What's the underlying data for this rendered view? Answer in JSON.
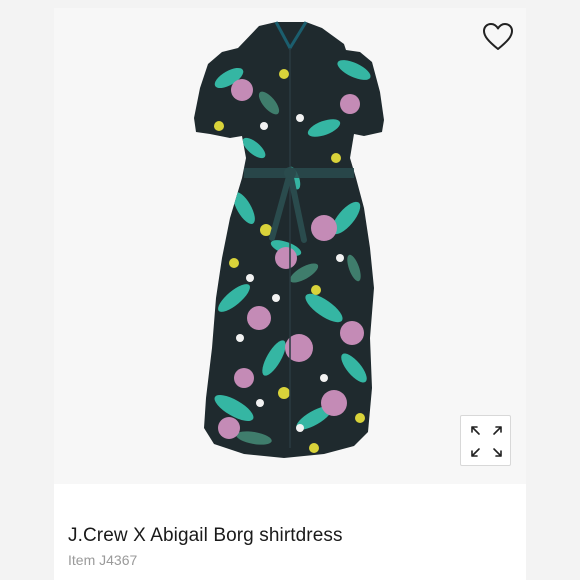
{
  "product": {
    "title": "J.Crew X Abigail Borg shirtdress",
    "item_number": "Item J4367",
    "image_alt": "floral-print-shirtdress"
  },
  "actions": {
    "favorite_icon": "heart-outline-icon",
    "expand_icon": "expand-arrows-icon"
  },
  "colors": {
    "page_bg": "#f3f3f3",
    "card_bg": "#ffffff",
    "dress_base": "#1f2a2e",
    "teal_leaf": "#35b6a3",
    "pink_flower": "#c48bb6",
    "yellow_flower": "#d9d33a",
    "title_text": "#1a1a1a",
    "item_text": "#9a9a9a"
  }
}
